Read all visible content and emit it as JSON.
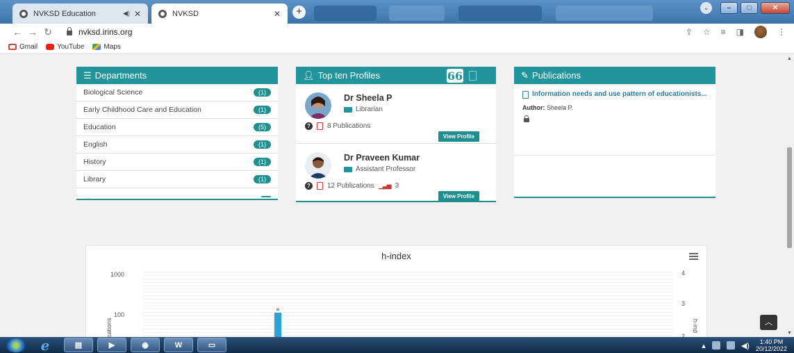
{
  "browser": {
    "tabs": [
      {
        "title": "NVKSD Education",
        "active": false
      },
      {
        "title": "NVKSD",
        "active": true
      }
    ],
    "new_tab": "+",
    "url": "nvksd.irins.org",
    "bookmarks": [
      {
        "label": "Gmail",
        "icon": "gmail-icon"
      },
      {
        "label": "YouTube",
        "icon": "youtube-icon"
      },
      {
        "label": "Maps",
        "icon": "maps-icon"
      }
    ]
  },
  "departments": {
    "title": "Departments",
    "items": [
      {
        "label": "Biological Science",
        "count": "(1)"
      },
      {
        "label": "Early Childhood Care and Education",
        "count": "(1)"
      },
      {
        "label": "Education",
        "count": "(5)"
      },
      {
        "label": "English",
        "count": "(1)"
      },
      {
        "label": "History",
        "count": "(1)"
      },
      {
        "label": "Library",
        "count": "(1)"
      }
    ]
  },
  "profiles": {
    "title": "Top ten Profiles",
    "quote_icon": "66",
    "items": [
      {
        "name": "Dr Sheela P",
        "role": "Librarian",
        "publications": "8 Publications",
        "extra": "",
        "button": "View Profile"
      },
      {
        "name": "Dr Praveen Kumar",
        "role": "Assistant Professor",
        "publications": "12 Publications",
        "extra": "3",
        "button": "View Profile"
      }
    ]
  },
  "publications": {
    "title": "Publications",
    "items": [
      {
        "title": "Information needs and use pattern of educationists...",
        "author_label": "Author:",
        "author": "Sheela P."
      }
    ]
  },
  "chart_data": {
    "type": "bar",
    "title": "h-index",
    "left_axis": {
      "scale": "log",
      "ticks": [
        "1000",
        "100"
      ],
      "label": "ications"
    },
    "right_axis": {
      "ticks": [
        "4",
        "3",
        "2"
      ],
      "label": "h-ind"
    },
    "bar_label": "≡",
    "colors": {
      "bar": "#2ba3d8",
      "grid": "#e6e6e6"
    }
  },
  "taskbar": {
    "time": "1:40 PM",
    "date": "20/12/2022"
  },
  "colors": {
    "accent": "#21959b",
    "link": "#2a7fa3"
  }
}
